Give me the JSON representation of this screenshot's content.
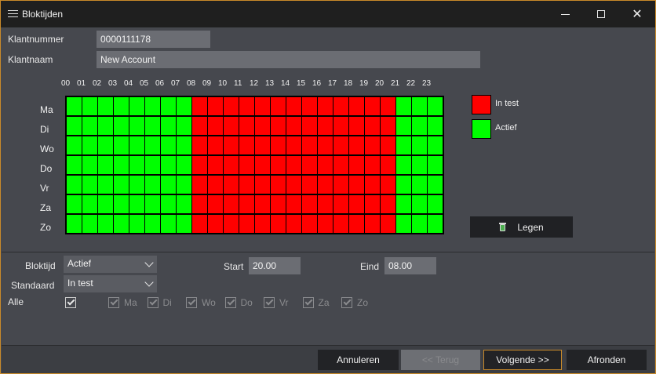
{
  "window": {
    "title": "Bloktijden"
  },
  "fields": {
    "klantnummer_label": "Klantnummer",
    "klantnummer_value": "0000111178",
    "klantnaam_label": "Klantnaam",
    "klantnaam_value": "New Account"
  },
  "schedule": {
    "hours": [
      "00",
      "01",
      "02",
      "03",
      "04",
      "05",
      "06",
      "07",
      "08",
      "09",
      "10",
      "11",
      "12",
      "13",
      "14",
      "15",
      "16",
      "17",
      "18",
      "19",
      "20",
      "21",
      "22",
      "23"
    ],
    "days": [
      "Ma",
      "Di",
      "Wo",
      "Do",
      "Vr",
      "Za",
      "Zo"
    ],
    "rows": [
      "aaaaaaaatttttttttttttaaaa",
      "aaaaaaaatttttttttttttaaaa",
      "aaaaaaaatttttttttttttaaaa",
      "aaaaaaaatttttttttttttaaaa",
      "aaaaaaaatttttttttttttaaaa",
      "aaaaaaaatttttttttttttaaaa",
      "aaaaaaaatttttttttttttaaaa"
    ],
    "colors": {
      "in_test": "#ff0000",
      "actief": "#00ff00"
    }
  },
  "legend": {
    "in_test": "In test",
    "actief": "Actief"
  },
  "legen_button": "Legen",
  "form": {
    "bloktijd_label": "Bloktijd",
    "bloktijd_value": "Actief",
    "standaard_label": "Standaard",
    "standaard_value": "In test",
    "start_label": "Start",
    "start_value": "20.00",
    "eind_label": "Eind",
    "eind_value": "08.00",
    "alle_label": "Alle",
    "days": [
      "Ma",
      "Di",
      "Wo",
      "Do",
      "Vr",
      "Za",
      "Zo"
    ]
  },
  "footer": {
    "annuleren": "Annuleren",
    "terug": "<< Terug",
    "volgende": "Volgende >>",
    "afronden": "Afronden"
  }
}
